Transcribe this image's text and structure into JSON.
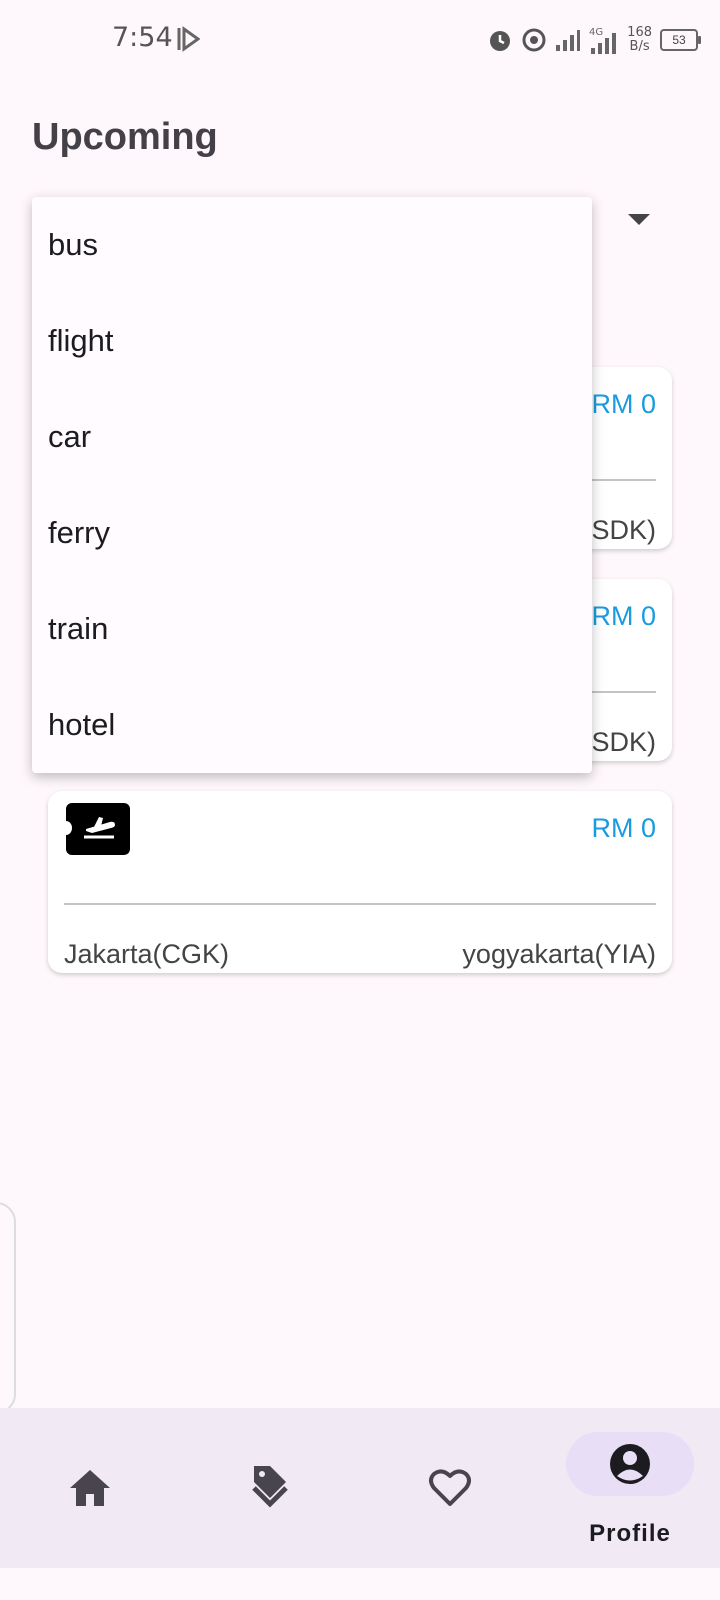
{
  "status_bar": {
    "time": "7:54",
    "net_speed_value": "168",
    "net_speed_unit": "B/s",
    "network": "4G",
    "battery": "53"
  },
  "header": {
    "title": "Upcoming"
  },
  "dropdown": {
    "options": [
      "bus",
      "flight",
      "car",
      "ferry",
      "train",
      "hotel"
    ]
  },
  "bookings": [
    {
      "price": "RM 0",
      "origin": "",
      "destination": "SDK)"
    },
    {
      "price": "RM 0",
      "origin": "",
      "destination": "SDK)"
    },
    {
      "price": "RM 0",
      "origin": "Jakarta(CGK)",
      "destination": "yogyakarta(YIA)",
      "icon": "flight-ticket-icon"
    }
  ],
  "bottom_nav": {
    "items": [
      {
        "icon": "home-icon"
      },
      {
        "icon": "tags-icon"
      },
      {
        "icon": "heart-icon"
      },
      {
        "icon": "account-circle-icon",
        "label": "Profile",
        "active": true
      }
    ]
  }
}
